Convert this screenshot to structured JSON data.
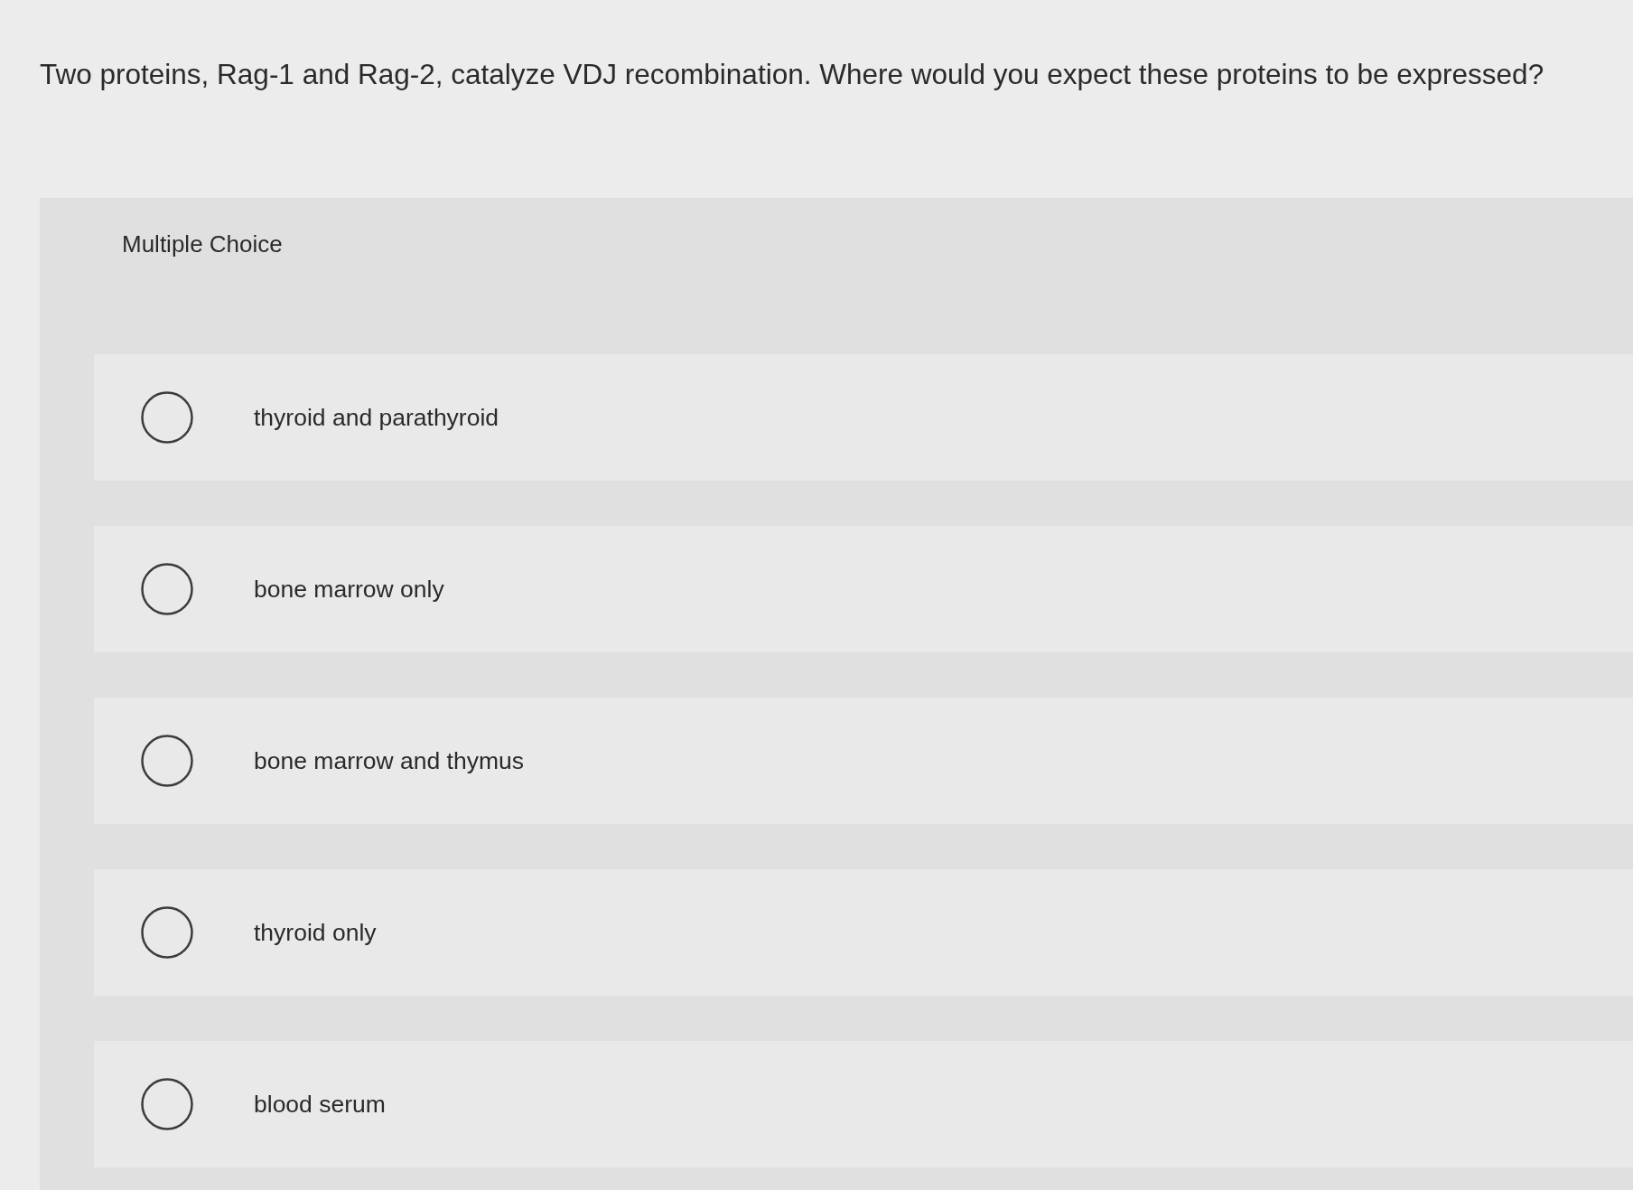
{
  "question": "Two proteins, Rag-1 and Rag-2, catalyze VDJ recombination. Where would you expect these proteins to be expressed?",
  "section": {
    "title": "Multiple Choice"
  },
  "options": [
    {
      "label": "thyroid and parathyroid",
      "selected": false
    },
    {
      "label": "bone marrow only",
      "selected": false
    },
    {
      "label": "bone marrow and thymus",
      "selected": false
    },
    {
      "label": "thyroid only",
      "selected": false
    },
    {
      "label": "blood serum",
      "selected": false
    }
  ]
}
